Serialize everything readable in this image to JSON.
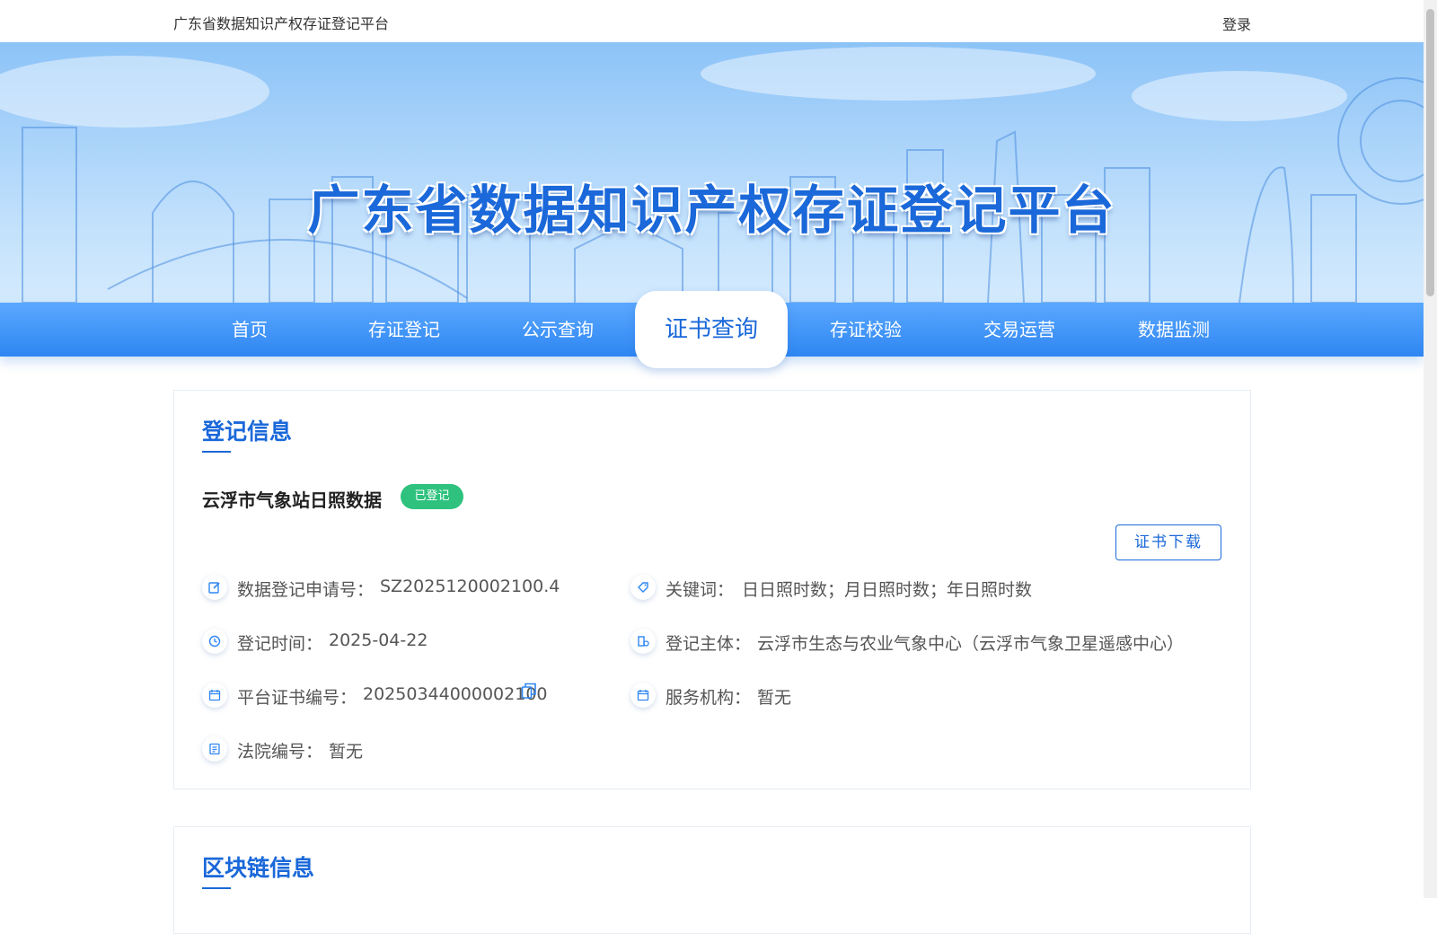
{
  "header": {
    "site_name": "广东省数据知识产权存证登记平台",
    "login_label": "登录"
  },
  "banner": {
    "title": "广东省数据知识产权存证登记平台"
  },
  "nav": {
    "items": [
      "首页",
      "存证登记",
      "公示查询",
      "证书查询",
      "存证校验",
      "交易运营",
      "数据监测"
    ],
    "active": "证书查询"
  },
  "registration": {
    "section_title": "登记信息",
    "dataset_name": "云浮市气象站日照数据",
    "status_badge": "已登记",
    "download_label": "证书下载",
    "fields": {
      "application_no": {
        "label": "数据登记申请号：",
        "value": "SZ2025120002100.4",
        "icon": "edit-icon"
      },
      "keywords": {
        "label": "关键词：",
        "value": "日日照时数；月日照时数；年日照时数",
        "icon": "tag-icon"
      },
      "reg_time": {
        "label": "登记时间：",
        "value": "2025-04-22",
        "icon": "clock-icon"
      },
      "subject": {
        "label": "登记主体：",
        "value": "云浮市生态与农业气象中心（云浮市气象卫星遥感中心）",
        "icon": "building-icon"
      },
      "cert_no": {
        "label": "平台证书编号：",
        "value": "20250344000002100",
        "icon": "calendar-icon"
      },
      "service_org": {
        "label": "服务机构：",
        "value": "暂无",
        "icon": "calendar-icon"
      },
      "court_no": {
        "label": "法院编号：",
        "value": "暂无",
        "icon": "document-icon"
      }
    }
  },
  "blockchain": {
    "section_title": "区块链信息"
  },
  "colors": {
    "primary": "#1a68d9",
    "badge": "#2ec27e",
    "nav_top": "#5aa8ff",
    "nav_bottom": "#2f86f2"
  }
}
